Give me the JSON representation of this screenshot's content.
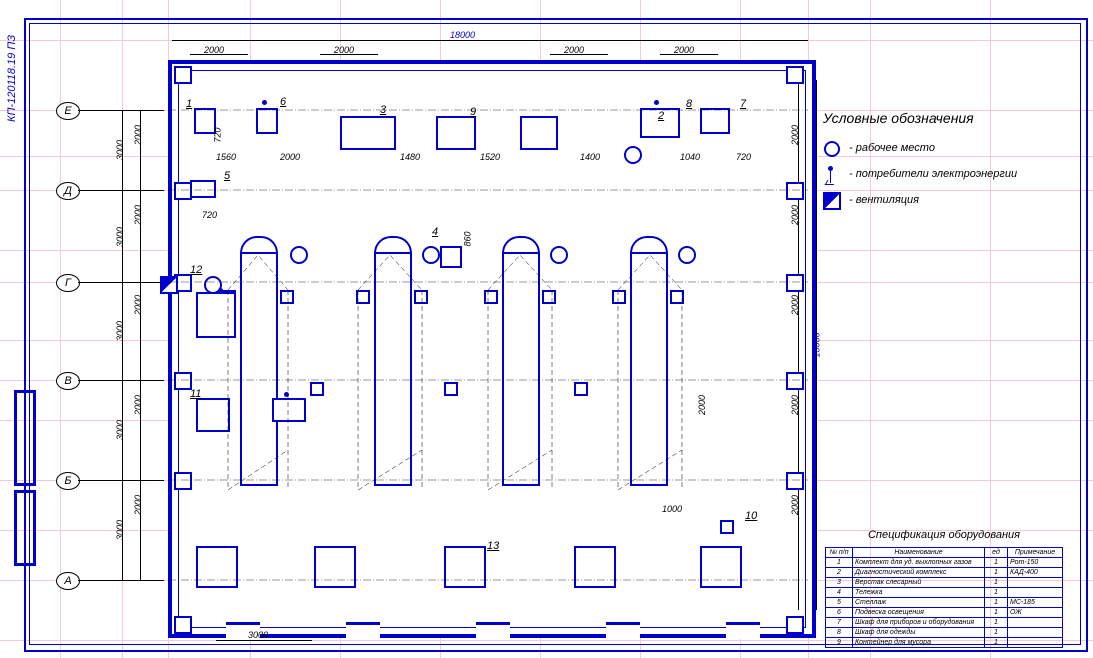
{
  "drawing_code": "КП-120118.19 ПЗ",
  "legend": {
    "title": "Условные обозначения",
    "items": [
      {
        "sym": "circle",
        "label": "- рабочее место"
      },
      {
        "sym": "elec",
        "label": "- потребители электроэнергии"
      },
      {
        "sym": "vent",
        "label": "- вентиляция"
      }
    ]
  },
  "axes": {
    "rows": [
      "Е",
      "Д",
      "Г",
      "В",
      "Б",
      "А"
    ],
    "row_y": [
      110,
      190,
      282,
      380,
      480,
      580
    ]
  },
  "dimensions": {
    "overall_h": "18000",
    "overall_v": "18000",
    "bay_h": [
      "2000",
      "2000",
      "2000",
      "2000"
    ],
    "inner": [
      "720",
      "1560",
      "2000",
      "1480",
      "1520",
      "1400",
      "1040",
      "720",
      "720",
      "1000",
      "3000",
      "860"
    ],
    "row_span": [
      "3000",
      "3000",
      "3000",
      "3000",
      "3000",
      "3000"
    ],
    "col_span": [
      "2000",
      "2000",
      "2000",
      "2000",
      "2000",
      "2000",
      "2000",
      "2000",
      "2000",
      "2000"
    ]
  },
  "callouts": {
    "1": "1",
    "2": "2",
    "3": "3",
    "4": "4",
    "5": "5",
    "6": "6",
    "7": "7",
    "8": "8",
    "9": "9",
    "10": "10",
    "11": "11",
    "12": "12",
    "13": "13"
  },
  "spec": {
    "title": "Спецификация оборудования",
    "headers": [
      "№ п/п",
      "Наименование",
      "ед",
      "Примечание"
    ],
    "rows": [
      [
        "1",
        "Комплект для уд. выхлопных газов",
        "1",
        "Рот-150"
      ],
      [
        "2",
        "Диагностический комплекс",
        "1",
        "КАД-400"
      ],
      [
        "3",
        "Верстак слесарный",
        "1",
        ""
      ],
      [
        "4",
        "Тележка",
        "1",
        ""
      ],
      [
        "5",
        "Стеллаж",
        "1",
        "МС-185"
      ],
      [
        "6",
        "Подвеска освещения",
        "1",
        "ОЖ"
      ],
      [
        "7",
        "Шкаф для приборов и оборудования",
        "1",
        ""
      ],
      [
        "8",
        "Шкаф для одежды",
        "1",
        ""
      ],
      [
        "9",
        "Контейнер для мусора",
        "1",
        ""
      ]
    ]
  }
}
